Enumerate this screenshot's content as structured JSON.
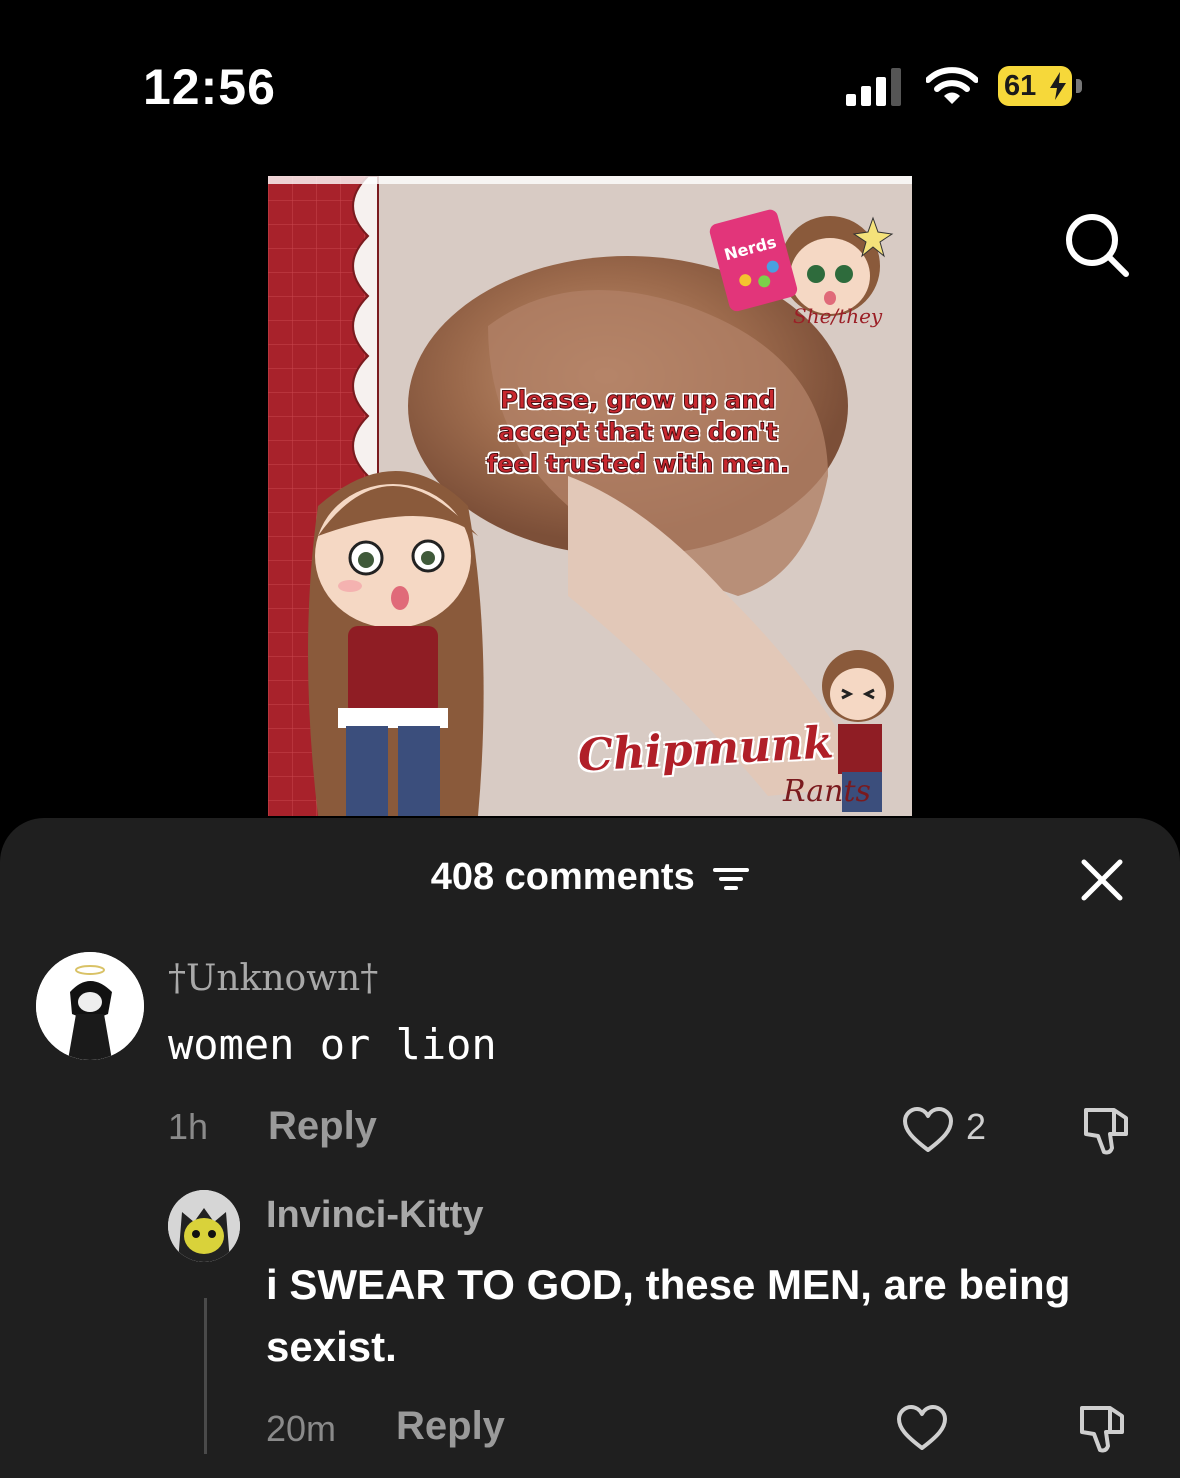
{
  "status_bar": {
    "time": "12:56",
    "battery_percent": "61",
    "charging": true,
    "signal_icon": "cellular-signal-icon",
    "wifi_icon": "wifi-icon"
  },
  "video": {
    "caption": "Please, grow up and accept that we don't feel trusted with men.",
    "watermark": "Chipmunk",
    "watermark_sub": "Rants",
    "pronouns": "She/they",
    "search_icon": "search-icon"
  },
  "comments_sheet": {
    "title": "408 comments",
    "filter_icon": "filter-icon",
    "close_icon": "close-icon",
    "comments": [
      {
        "username": "†Unknown†",
        "text": "women or lion",
        "time": "1h",
        "reply_label": "Reply",
        "likes": "2"
      },
      {
        "username": "Invinci-Kitty",
        "text": "i SWEAR TO GOD, these MEN, are being sexist.",
        "time": "20m",
        "reply_label": "Reply",
        "likes": ""
      }
    ]
  },
  "colors": {
    "sheet_bg": "#1f1f1f",
    "battery": "#f6d83a",
    "caption_red": "#c8282f"
  }
}
